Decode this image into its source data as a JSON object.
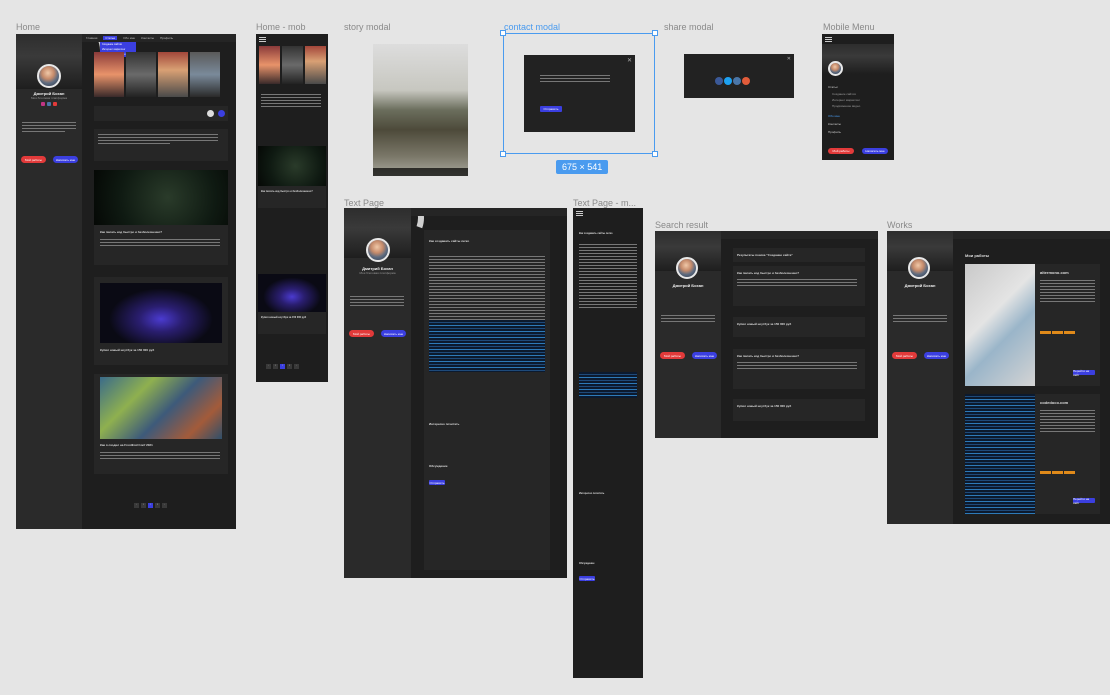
{
  "frames": {
    "home": "Home",
    "home_mob": "Home - mob",
    "story_modal": "story modal",
    "contact_modal": "contact modal",
    "share_modal": "share modal",
    "mobile_menu": "Mobile Menu",
    "text_page": "Text Page",
    "text_page_mob": "Text Page - m...",
    "search_result": "Search result",
    "works": "Works"
  },
  "selection_size": "675 × 541",
  "profile": {
    "name": "Дмитрий Бохан",
    "subtitle": "Моя блоговая платформа"
  },
  "buttons": {
    "primary": "Мой работы",
    "secondary": "Написать мне",
    "send": "Отправить"
  },
  "posts": [
    {
      "title": "Как писать код быстро и безболезненно?"
    },
    {
      "title": "Купил новый ноутбук за 150 000 руб"
    },
    {
      "title": "Как я сходил на FrontEnd Conf 2021"
    }
  ],
  "mobile_posts": [
    {
      "title": "Как писать код быстро и безболезненно?"
    },
    {
      "title": "Купил новый ноутбук за 150 000 руб"
    }
  ],
  "text_page": {
    "title": "Как создавать сайты легко",
    "comments": "Обсуждение",
    "related": "Интересно почитать"
  },
  "search": {
    "heading": "Результаты поиска \"Создание сайта\"",
    "results": [
      "Как писать код быстро и безболезненно?",
      "Купил новый ноутбук за 150 000 руб",
      "Как писать код быстро и безболезненно?",
      "Купил новый ноутбук за 150 000 руб"
    ]
  },
  "works": {
    "heading": "Мои работы",
    "items": [
      "altermono.com",
      "codedoco.com"
    ],
    "link": "Перейти на сайт"
  },
  "mobile_menu": {
    "items": [
      "Статьи",
      "Создание сайтов",
      "Интернет маркетинг",
      "Продвижение видео",
      "Обо мне",
      "Контакты",
      "Профиль"
    ]
  },
  "nav": [
    "Главная",
    "Статьи",
    "Обо мне",
    "Контакты",
    "Профиль"
  ],
  "dropdown": [
    "Создание сайтов",
    "Интернет маркетинг",
    "Продвижение видео"
  ],
  "pager": [
    "‹",
    "1",
    "2",
    "3",
    "›"
  ],
  "colors": {
    "accent_red": "#e23a3a",
    "accent_blue": "#3b3fe0",
    "selection": "#4a9bef",
    "canvas": "#e5e5e5",
    "frame_bg": "#1e1e1e"
  }
}
